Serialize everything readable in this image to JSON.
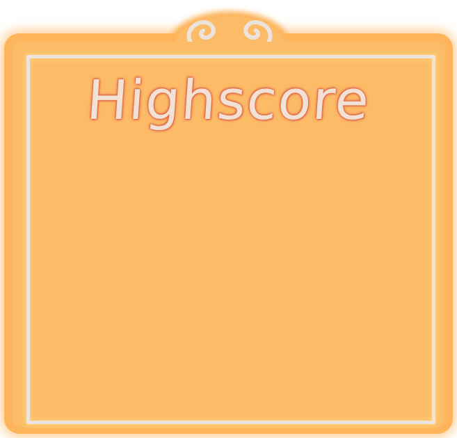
{
  "highscore_panel": {
    "title": "Highscore",
    "entries": []
  },
  "colors": {
    "panel_fill": "#fcbb67",
    "panel_glow": "#fdb45a",
    "frame_line": "#ece3dc",
    "title_text": "#f2e2d6",
    "title_outline": "#e06a4a"
  },
  "icons": {
    "ornament": "curl-scroll-icon"
  }
}
